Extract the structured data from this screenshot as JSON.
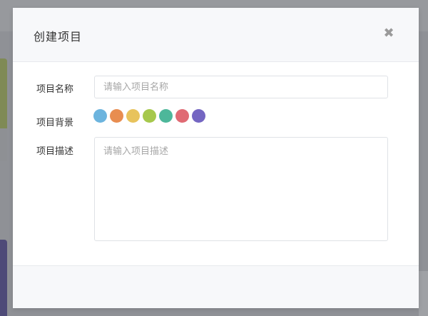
{
  "modal": {
    "title": "创建项目",
    "close_symbol": "✖"
  },
  "form": {
    "name": {
      "label": "项目名称",
      "placeholder": "请输入项目名称",
      "value": ""
    },
    "background": {
      "label": "项目背景",
      "colors": [
        {
          "name": "blue",
          "hex": "#6cb4de"
        },
        {
          "name": "orange",
          "hex": "#e88d50"
        },
        {
          "name": "yellow",
          "hex": "#e8c35c"
        },
        {
          "name": "green",
          "hex": "#a6c84c"
        },
        {
          "name": "teal",
          "hex": "#4db79a"
        },
        {
          "name": "red",
          "hex": "#e06a73"
        },
        {
          "name": "purple",
          "hex": "#7466c2"
        }
      ]
    },
    "description": {
      "label": "项目描述",
      "placeholder": "请输入项目描述",
      "value": ""
    }
  }
}
